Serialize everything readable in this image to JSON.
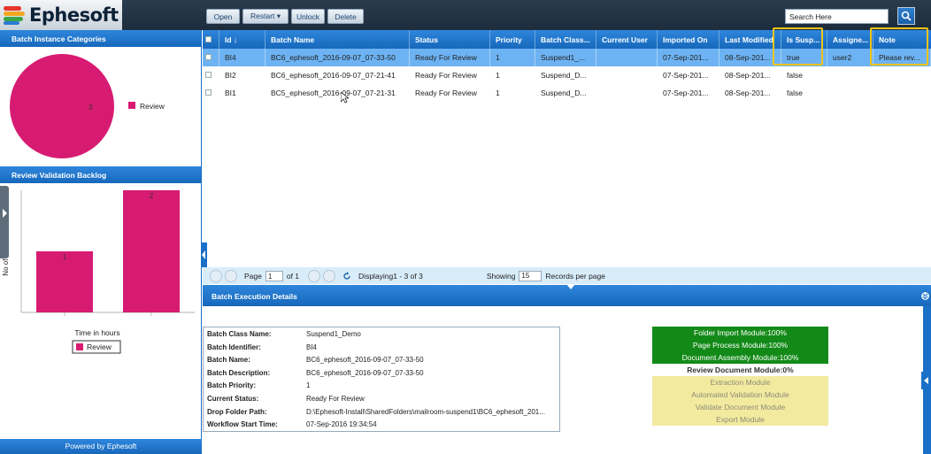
{
  "header": {
    "logo_text": "Ephesoft",
    "buttons": {
      "open": "Open",
      "restart": "Restart ▾",
      "unlock": "Unlock",
      "delete": "Delete"
    },
    "search_placeholder": "Search Here"
  },
  "left": {
    "pie_title": "Batch Instance Categories",
    "pie_value_label": "3",
    "pie_legend": "Review",
    "bar_title": "Review Validation Backlog",
    "bar_ylabel": "No of batches",
    "bar_xlabel": "Time in hours",
    "bar_legend": "Review",
    "footer": "Powered by Ephesoft"
  },
  "chart_data": [
    {
      "type": "pie",
      "title": "Batch Instance Categories",
      "slices": [
        {
          "label": "Review",
          "value": 3
        }
      ],
      "legend_position": "right"
    },
    {
      "type": "bar",
      "title": "Review Validation Backlog",
      "categories": [
        "",
        ""
      ],
      "values": [
        1,
        2
      ],
      "data_labels": [
        "1",
        "2"
      ],
      "xlabel": "Time in hours",
      "ylabel": "No of batches",
      "ylim": [
        0,
        2
      ],
      "legend": [
        "Review"
      ],
      "legend_position": "bottom"
    }
  ],
  "grid": {
    "columns": {
      "id": "Id ↓",
      "name": "Batch Name",
      "status": "Status",
      "priority": "Priority",
      "class": "Batch Class...",
      "user": "Current User",
      "imported": "Imported On",
      "modified": "Last Modified",
      "susp": "Is Susp...",
      "assigned": "Assigne...",
      "note": "Note"
    },
    "rows": [
      {
        "id": "BI4",
        "name": "BC6_ephesoft_2016-09-07_07-33-50",
        "status": "Ready For Review",
        "priority": "1",
        "class": "Suspend1_...",
        "user": "",
        "imported": "07-Sep-201...",
        "modified": "08-Sep-201...",
        "susp": "true",
        "assigned": "user2",
        "note": "Please rev..."
      },
      {
        "id": "BI2",
        "name": "BC6_ephesoft_2016-09-07_07-21-41",
        "status": "Ready For Review",
        "priority": "1",
        "class": "Suspend_D...",
        "user": "",
        "imported": "07-Sep-201...",
        "modified": "08-Sep-201...",
        "susp": "false",
        "assigned": "",
        "note": ""
      },
      {
        "id": "BI1",
        "name": "BC5_ephesoft_2016-09-07_07-21-31",
        "status": "Ready For Review",
        "priority": "1",
        "class": "Suspend_D...",
        "user": "",
        "imported": "07-Sep-201...",
        "modified": "08-Sep-201...",
        "susp": "false",
        "assigned": "",
        "note": ""
      }
    ]
  },
  "pager": {
    "page_label": "Page",
    "page_value": "1",
    "of_label": "of 1",
    "displaying": "Displaying1 - 3 of 3",
    "showing_label": "Showing",
    "per_page_value": "15",
    "records_label": "Records per page"
  },
  "details": {
    "title": "Batch Execution Details",
    "fields": [
      {
        "k": "Batch Class Name:",
        "v": "Suspend1_Demo"
      },
      {
        "k": "Batch Identifier:",
        "v": "BI4"
      },
      {
        "k": "Batch Name:",
        "v": "BC6_ephesoft_2016-09-07_07-33-50"
      },
      {
        "k": "Batch Description:",
        "v": "BC6_ephesoft_2016-09-07_07-33-50"
      },
      {
        "k": "Batch Priority:",
        "v": "1"
      },
      {
        "k": "Current Status:",
        "v": "Ready For Review"
      },
      {
        "k": "Drop Folder Path:",
        "v": "D:\\Ephesoft-Install\\SharedFolders\\mailroom-suspend1\\BC6_ephesoft_201..."
      },
      {
        "k": "Workflow Start Time:",
        "v": "07-Sep-2016 19:34:54"
      }
    ],
    "modules": [
      {
        "label": "Folder Import Module:100%",
        "state": "done"
      },
      {
        "label": "Page Process Module:100%",
        "state": "done"
      },
      {
        "label": "Document Assembly Module:100%",
        "state": "done"
      },
      {
        "label": "Review Document Module:0%",
        "state": "cur"
      },
      {
        "label": "Extraction Module",
        "state": "pend"
      },
      {
        "label": "Automated Validation Module",
        "state": "pend"
      },
      {
        "label": "Validate Document Module",
        "state": "pend"
      },
      {
        "label": "Export Module",
        "state": "pend"
      }
    ]
  },
  "colors": {
    "brand_blue": "#1a6fc6",
    "chart_pink": "#d81b72",
    "done_green": "#138a18",
    "pending_yellow": "#f2ea9f",
    "highlight": "#f0c419"
  }
}
